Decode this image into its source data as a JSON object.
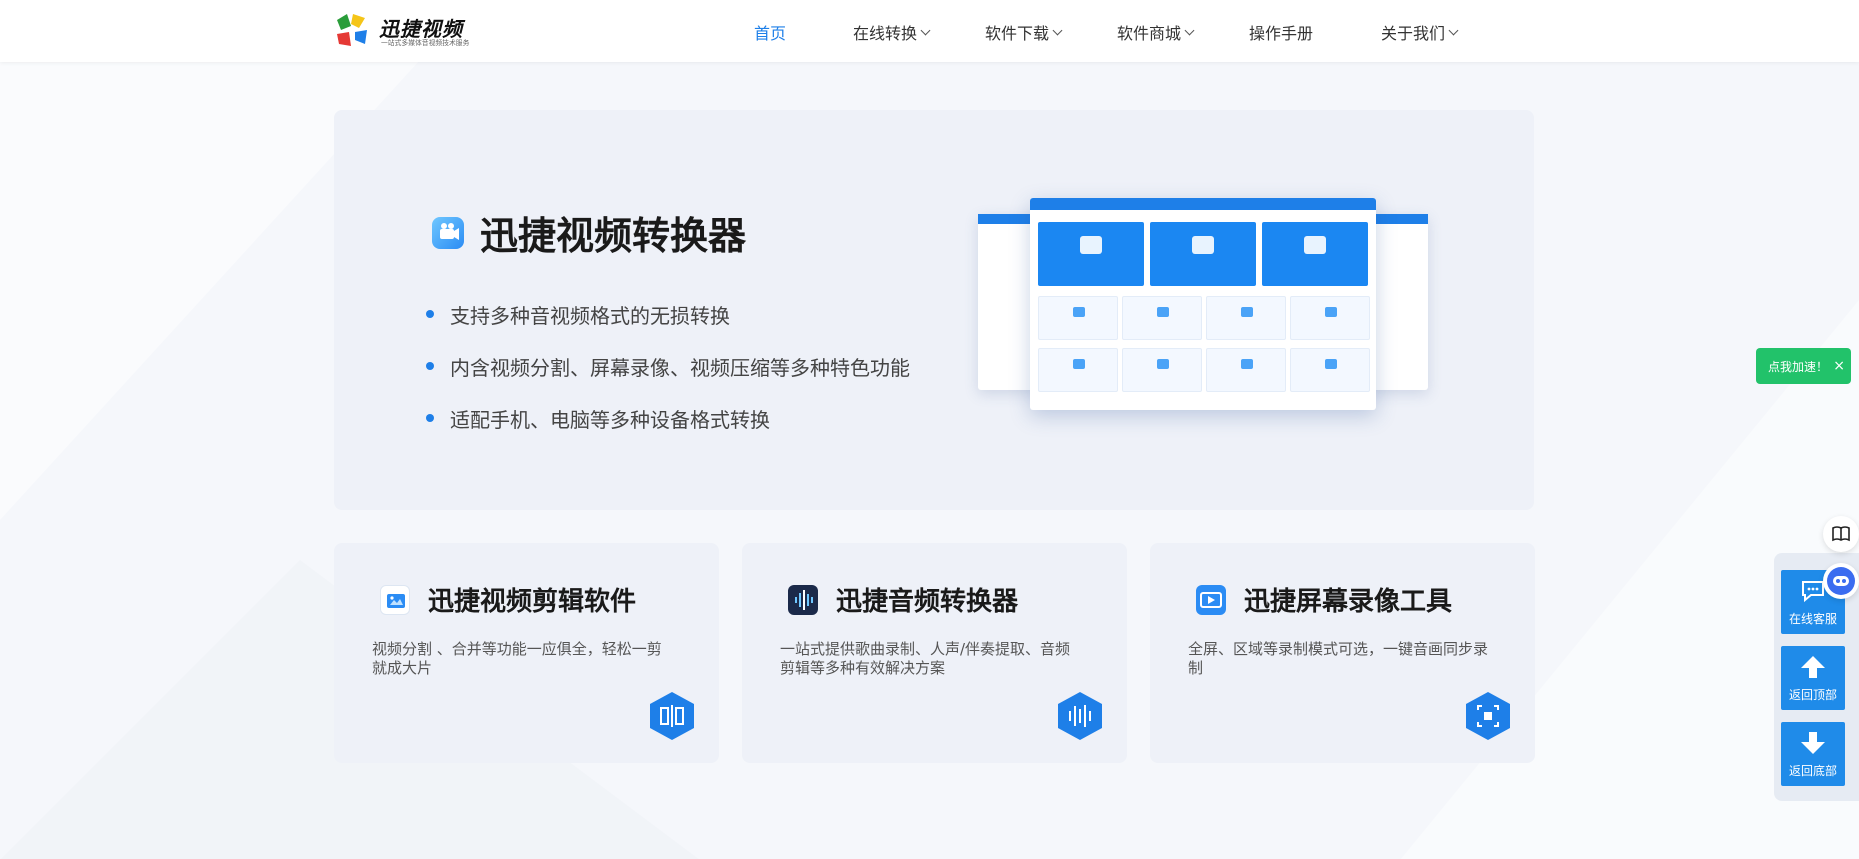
{
  "header": {
    "logo_title": "迅捷视频",
    "logo_subtitle": "一站式多媒体音视频技术服务",
    "nav": [
      {
        "label": "首页",
        "active": true,
        "dropdown": false
      },
      {
        "label": "在线转换",
        "active": false,
        "dropdown": true
      },
      {
        "label": "软件下载",
        "active": false,
        "dropdown": true
      },
      {
        "label": "软件商城",
        "active": false,
        "dropdown": true
      },
      {
        "label": "操作手册",
        "active": false,
        "dropdown": false
      },
      {
        "label": "关于我们",
        "active": false,
        "dropdown": true
      }
    ]
  },
  "hero": {
    "title": "迅捷视频转换器",
    "bullets": [
      "支持多种音视频格式的无损转换",
      "内含视频分割、屏幕录像、视频压缩等多种特色功能",
      "适配手机、电脑等多种设备格式转换"
    ]
  },
  "cards": [
    {
      "title": "迅捷视频剪辑软件",
      "desc": "视频分割 、合并等功能一应俱全，轻松一剪就成大片",
      "icon": "video-edit-icon"
    },
    {
      "title": "迅捷音频转换器",
      "desc": "一站式提供歌曲录制、人声/伴奏提取、音频剪辑等多种有效解决方案",
      "icon": "audio-wave-icon"
    },
    {
      "title": "迅捷屏幕录像工具",
      "desc": "全屏、区域等录制模式可选，一键音画同步录制",
      "icon": "screen-record-icon"
    }
  ],
  "side": {
    "toast": "点我加速！",
    "toast_close": "×",
    "buttons": [
      "在线客服",
      "返回顶部",
      "返回底部"
    ]
  },
  "colors": {
    "accent": "#1e7fe8",
    "toast": "#22c26a",
    "side_button": "#1f8be9"
  }
}
